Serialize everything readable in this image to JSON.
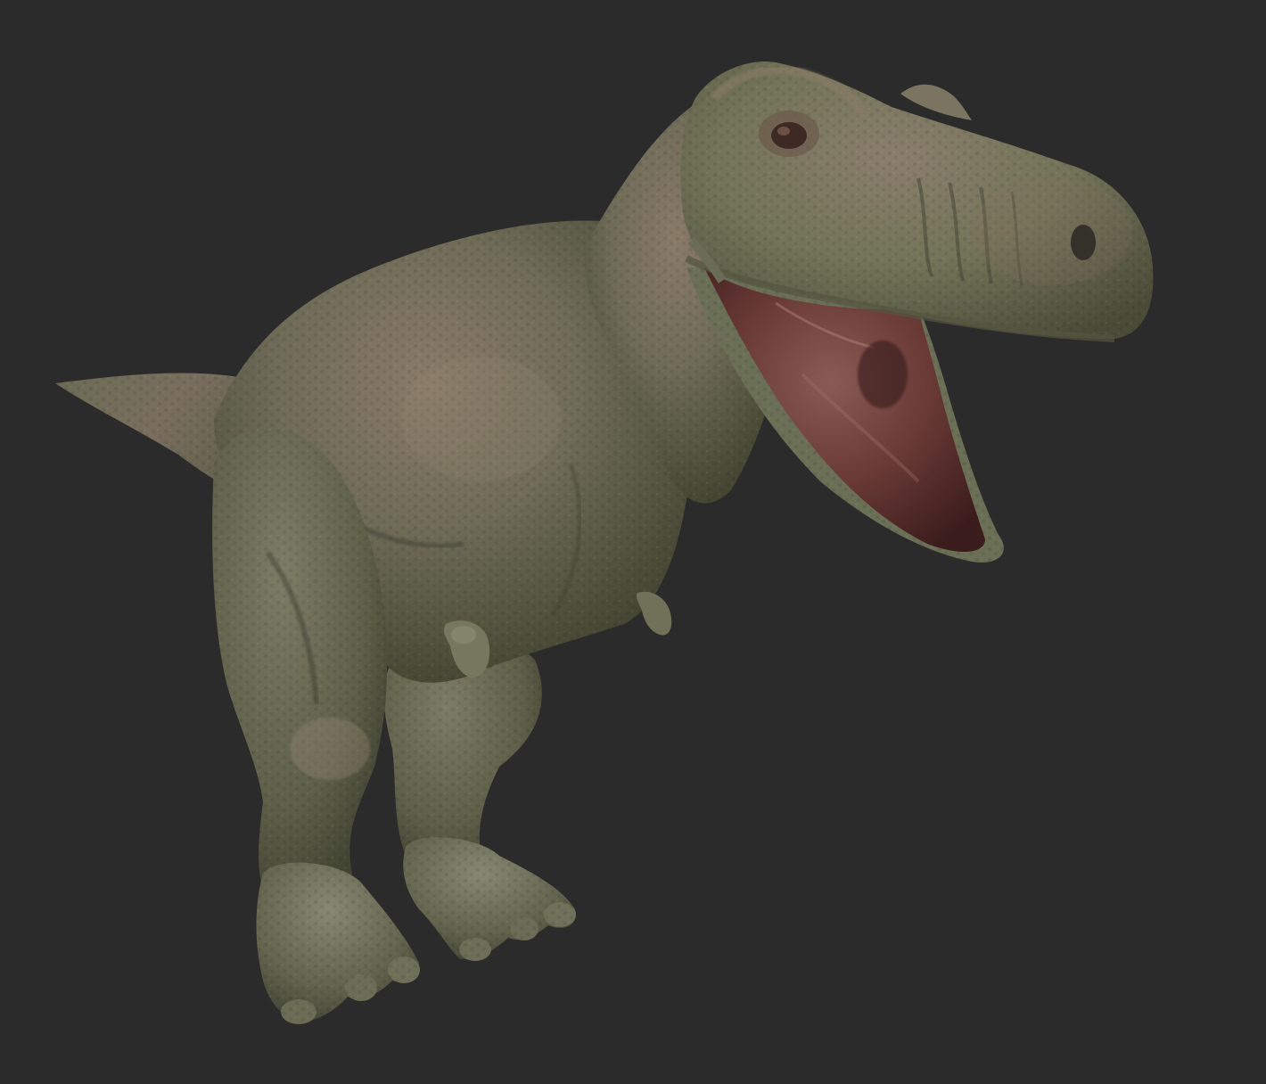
{
  "viewport": {
    "background": "#2b2b2b",
    "subject": "tyrannosaurus-rex-3d-render"
  },
  "colors": {
    "skin_base": "#6b6d58",
    "skin_light": "#8a8c72",
    "skin_dark": "#3f4135",
    "skin_shadow": "#2f3128",
    "skin_warm": "#7a6a5c",
    "mouth_inner": "#5a3030",
    "mouth_light": "#8a5550",
    "mouth_dark": "#3a1c1c",
    "eye": "#4a2e28"
  }
}
